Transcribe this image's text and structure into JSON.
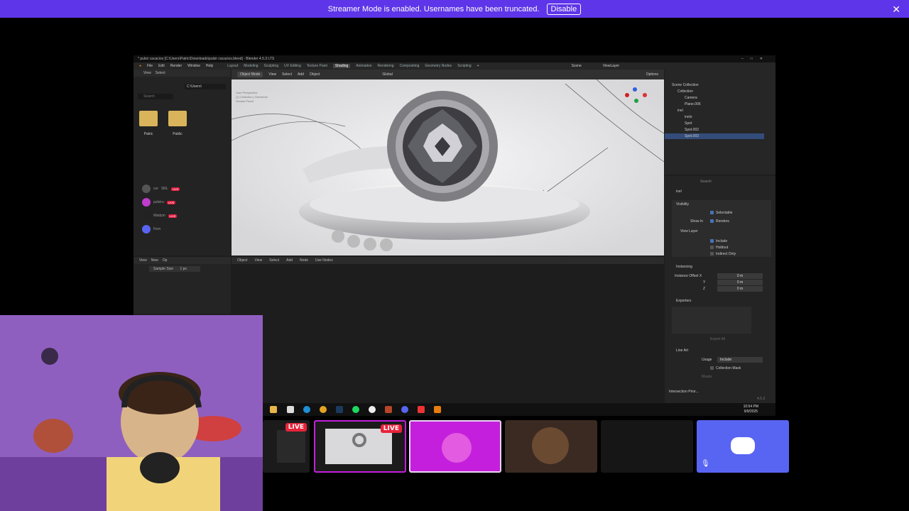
{
  "banner": {
    "message": "Streamer Mode is enabled. Usernames have been truncated.",
    "disable_label": "Disable"
  },
  "blender": {
    "title": "* pulsir cacacios [C:\\Users\\Patric\\Downloads\\pulsir cacacios.blend] - Blender 4.5.3 LTS",
    "menu": [
      "File",
      "Edit",
      "Render",
      "Window",
      "Help"
    ],
    "workspaces": [
      "Layout",
      "Modeling",
      "Sculpting",
      "UV Editing",
      "Texture Paint",
      "Shading",
      "Animation",
      "Rendering",
      "Compositing",
      "Geometry Nodes",
      "Scripting"
    ],
    "active_workspace": "Shading",
    "file_browser": {
      "header": [
        "View",
        "Select"
      ],
      "path": "C:\\Users\\",
      "search_placeholder": "Search",
      "folders": [
        "Patric",
        "Public"
      ]
    },
    "voice_users": [
      {
        "name": "cor",
        "extra": "SRL",
        "badge": "LIVE"
      },
      {
        "name": "pulsiru",
        "badge": "LIVE"
      },
      {
        "name": "Wadym",
        "badge": "LIVE"
      },
      {
        "name": "Fern"
      }
    ],
    "viewport": {
      "header": [
        "Object Mode",
        "View",
        "Select",
        "Add",
        "Object"
      ],
      "transform": "Global",
      "options": "Options",
      "overlay_lines": [
        "User Perspective",
        "(1) Collection | Gemstone",
        "Grease Pencil"
      ]
    },
    "outliner": {
      "search": "",
      "scene": "Scene",
      "view_layer": "ViewLayer",
      "rows": [
        {
          "label": "Scene Collection",
          "indent": 0,
          "selected": false
        },
        {
          "label": "Collection",
          "indent": 1,
          "selected": false
        },
        {
          "label": "Camera",
          "indent": 2,
          "selected": false
        },
        {
          "label": "Plane.006",
          "indent": 2,
          "selected": false
        },
        {
          "label": "inel",
          "indent": 1,
          "selected": false
        },
        {
          "label": "inelo",
          "indent": 2,
          "selected": false
        },
        {
          "label": "Spot",
          "indent": 2,
          "selected": false
        },
        {
          "label": "Spot.002",
          "indent": 2,
          "selected": false
        },
        {
          "label": "Spot.003",
          "indent": 2,
          "selected": true
        }
      ]
    },
    "properties": {
      "search_placeholder": "Search",
      "collection_name": "inel",
      "visibility_label": "Visibility",
      "selectable_label": "Selectable",
      "show_in_label": "Show In",
      "renders_label": "Renders",
      "view_layer_label": "View Layer",
      "include_label": "Include",
      "holdout_label": "Holdout",
      "indirect_only_label": "Indirect Only",
      "instancing_label": "Instancing",
      "instance_offset_label": "Instance Offset X",
      "y_label": "Y",
      "z_label": "Z",
      "offset_x": "0 m",
      "offset_y": "0 m",
      "offset_z": "0 m",
      "exporters_label": "Exporters",
      "export_all_label": "Export All",
      "line_art_label": "Line Art",
      "usage_label": "Usage",
      "usage_value": "Include",
      "collection_mask_label": "Collection Mask",
      "masks_label": "Masks",
      "intersection_label": "Intersection Prior..."
    },
    "node_editor": {
      "header": [
        "Object",
        "View",
        "Select",
        "Add",
        "Node",
        "Use Nodes"
      ]
    },
    "image_editor": {
      "header": [
        "View",
        "New",
        "Op"
      ],
      "sample_size_label": "Sample Size",
      "sample_size_value": "1 px"
    },
    "version": "4.5.3"
  },
  "taskbar": {
    "time": "10:54 PM",
    "date": "9/9/2025"
  },
  "stream_tiles": [
    {
      "badge": "LIVE"
    },
    {
      "badge": "LIVE"
    },
    {
      "badge": ""
    },
    {
      "badge": ""
    },
    {
      "badge": ""
    },
    {
      "badge": ""
    }
  ],
  "colors": {
    "banner": "#5e35e8",
    "live": "#e8233b",
    "discord": "#5865f2",
    "speaking_tile": "#c41fdc"
  }
}
